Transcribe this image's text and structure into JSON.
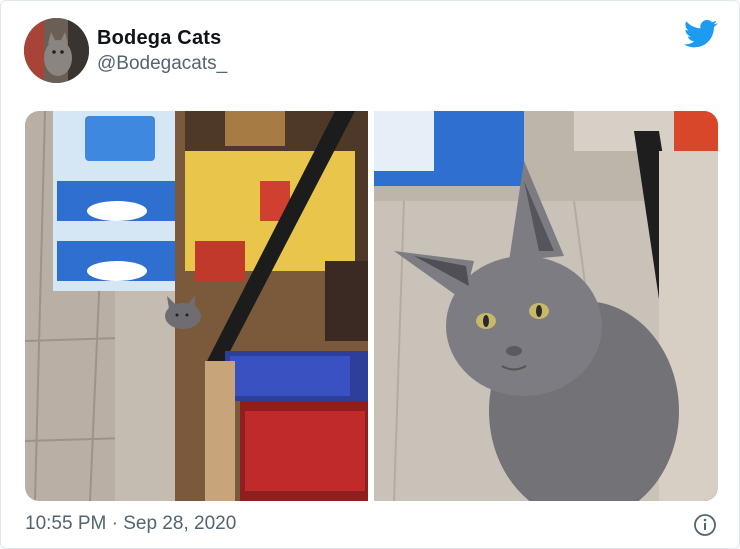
{
  "tweet": {
    "display_name": "Bodega Cats",
    "handle": "@Bodegacats_",
    "time": "10:55 PM",
    "separator": "·",
    "date": "Sep 28, 2020"
  },
  "icons": {
    "brand": "twitter-bird-icon",
    "info": "info-icon"
  },
  "colors": {
    "twitter_blue": "#1d9bf0",
    "secondary_text": "#536471"
  }
}
